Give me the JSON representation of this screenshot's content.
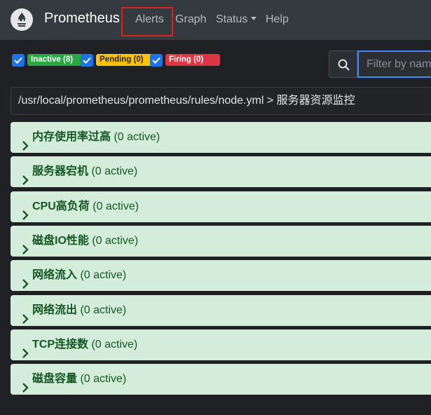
{
  "navbar": {
    "brand": "Prometheus",
    "items": [
      {
        "label": "Alerts"
      },
      {
        "label": "Graph"
      },
      {
        "label": "Status"
      },
      {
        "label": "Help"
      }
    ]
  },
  "filters": {
    "inactive": {
      "label": "Inactive (8)",
      "checked": true,
      "color": "#28a745"
    },
    "pending": {
      "label": "Pending (0)",
      "checked": true,
      "color": "#ffc107"
    },
    "firing": {
      "label": "Firing (0)",
      "checked": true,
      "color": "#dc3545"
    }
  },
  "search": {
    "placeholder": "Filter by name or labels",
    "value": ""
  },
  "rule_file": {
    "header": "/usr/local/prometheus/prometheus/rules/node.yml > 服务器资源监控"
  },
  "groups": [
    {
      "name": "内存使用率过高",
      "count": " (0 active)"
    },
    {
      "name": "服务器宕机",
      "count": " (0 active)"
    },
    {
      "name": "CPU高负荷",
      "count": " (0 active)"
    },
    {
      "name": "磁盘IO性能",
      "count": " (0 active)"
    },
    {
      "name": "网络流入",
      "count": " (0 active)"
    },
    {
      "name": "网络流出",
      "count": " (0 active)"
    },
    {
      "name": "TCP连接数",
      "count": " (0 active)"
    },
    {
      "name": "磁盘容量",
      "count": " (0 active)"
    }
  ],
  "colors": {
    "navbar": "#343a40",
    "background": "#202124",
    "group_bg": "#d4edda",
    "group_text": "#155724",
    "highlight": "#e02020"
  }
}
